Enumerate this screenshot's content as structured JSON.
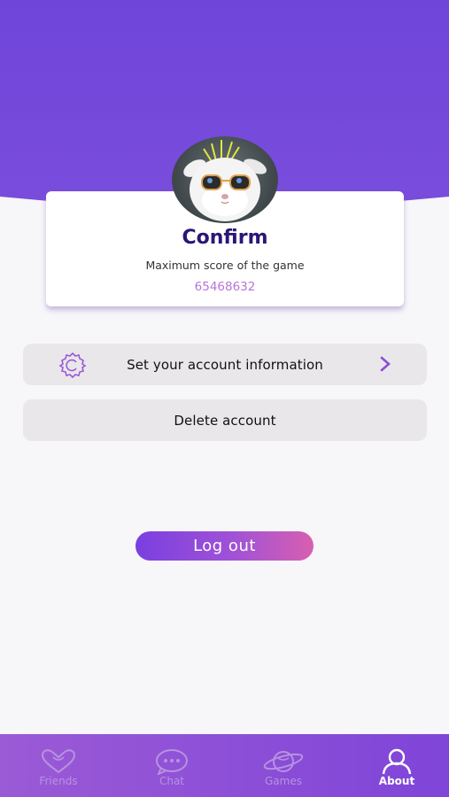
{
  "profile": {
    "title": "Confirm",
    "subtitle": "Maximum score of the game",
    "score": "65468632"
  },
  "menu": {
    "settings_label": "Set your account information",
    "delete_label": "Delete account"
  },
  "logout_label": "Log out",
  "tabs": [
    {
      "label": "Friends",
      "icon": "heart-chat-icon",
      "active": false
    },
    {
      "label": "Chat",
      "icon": "chat-bubble-icon",
      "active": false
    },
    {
      "label": "Games",
      "icon": "planet-icon",
      "active": false
    },
    {
      "label": "About",
      "icon": "person-icon",
      "active": true
    }
  ],
  "colors": {
    "primary": "#7349dc",
    "title": "#2b1577",
    "score": "#b874d6",
    "accent": "#9b5ad6"
  }
}
